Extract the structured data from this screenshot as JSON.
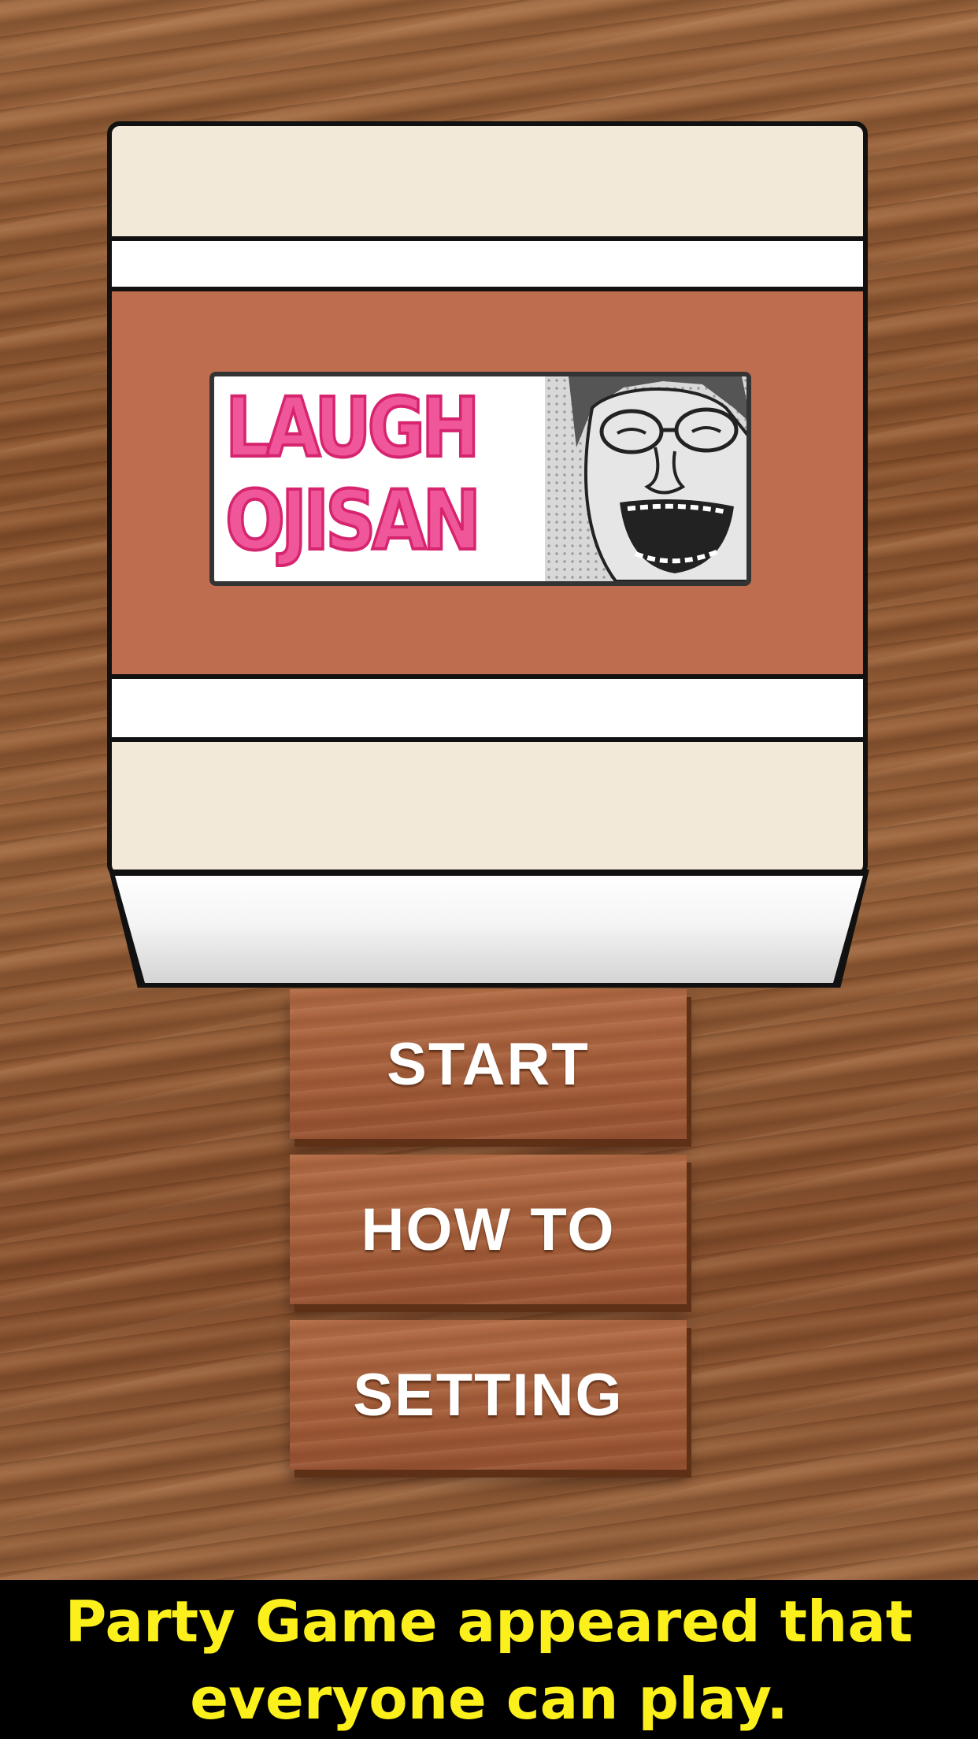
{
  "logo": {
    "line1": "LAUGH",
    "line2": "OJISAN",
    "icon": "laughing-ojisan-face-icon"
  },
  "menu": {
    "start_label": "START",
    "howto_label": "HOW TO",
    "setting_label": "SETTING"
  },
  "footer": {
    "line1": "Party Game appeared that",
    "line2": "everyone can play."
  },
  "colors": {
    "box_brown": "#be6e4f",
    "box_cream": "#f2e9d8",
    "logo_pink": "#f0569a",
    "footer_text": "#fbf01c"
  }
}
